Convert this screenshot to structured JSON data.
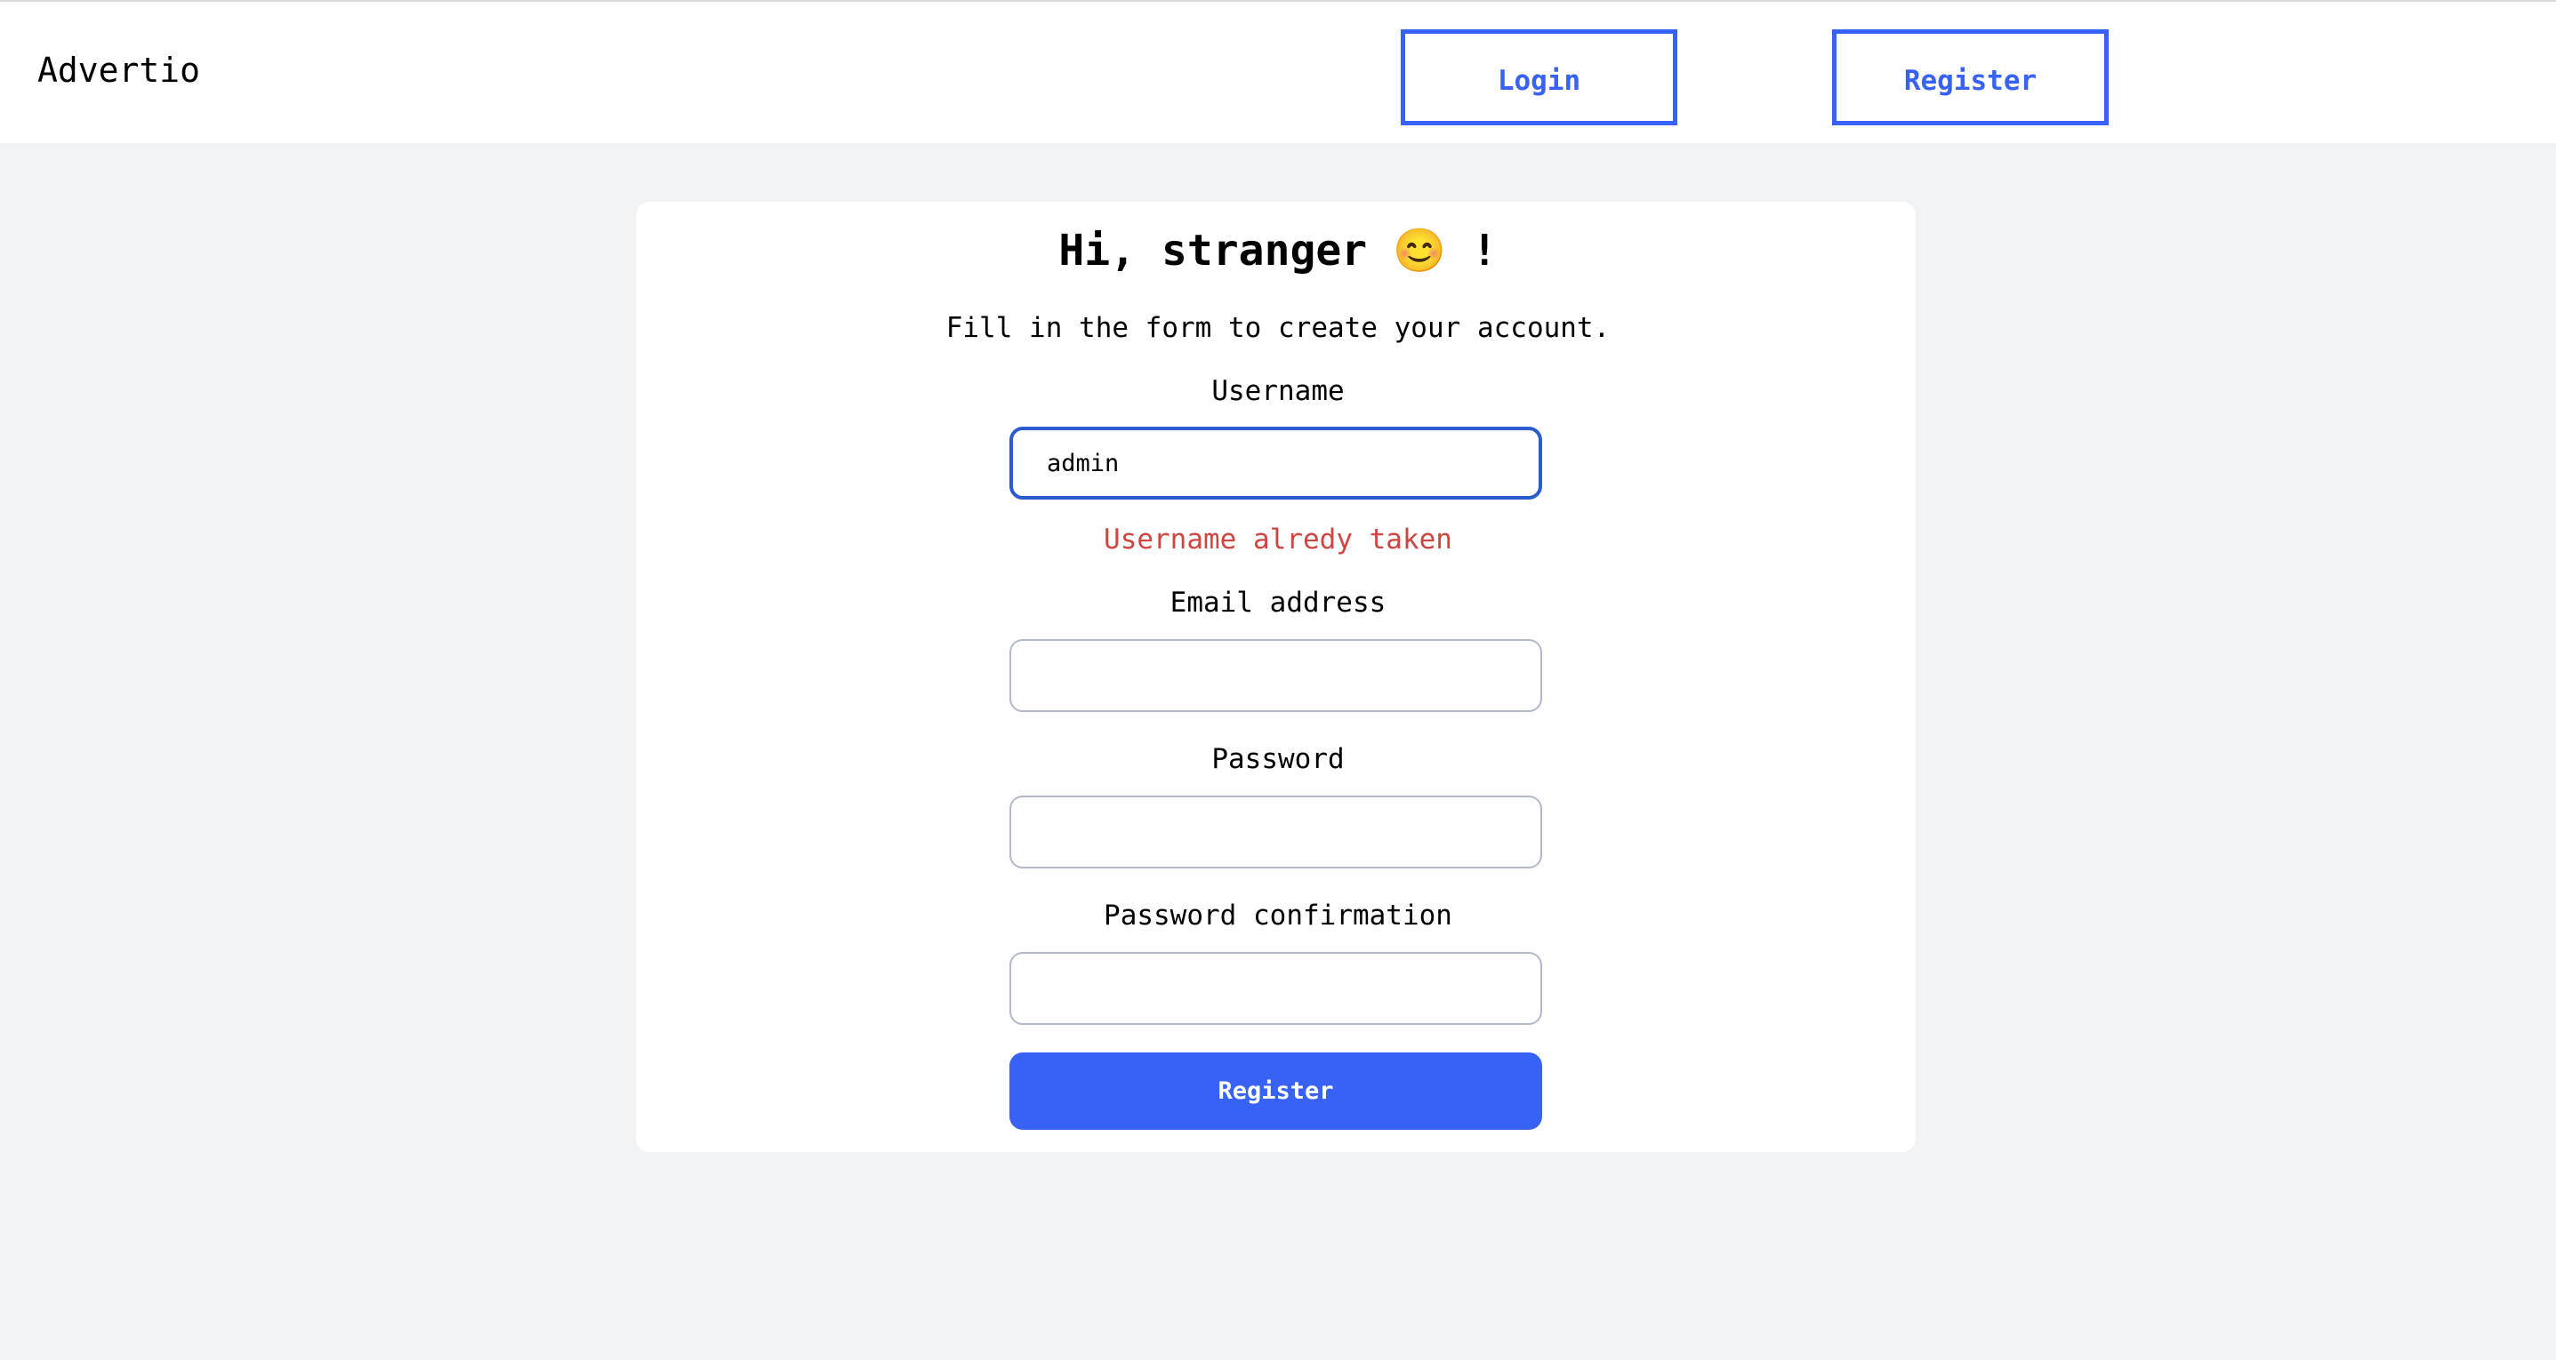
{
  "header": {
    "logo": "Advertio",
    "login_label": "Login",
    "register_label": "Register"
  },
  "form": {
    "title": "Hi, stranger 😊 !",
    "subtitle": "Fill in the form to create your account.",
    "username_label": "Username",
    "username_value": "admin",
    "username_error": "Username alredy taken",
    "email_label": "Email address",
    "email_value": "",
    "password_label": "Password",
    "password_value": "",
    "password_confirmation_label": "Password confirmation",
    "password_confirmation_value": "",
    "submit_label": "Register"
  },
  "colors": {
    "accent": "#3862f5",
    "error": "#d0453f",
    "focus_border": "#2b5ccf",
    "background": "#f2f3f5"
  }
}
